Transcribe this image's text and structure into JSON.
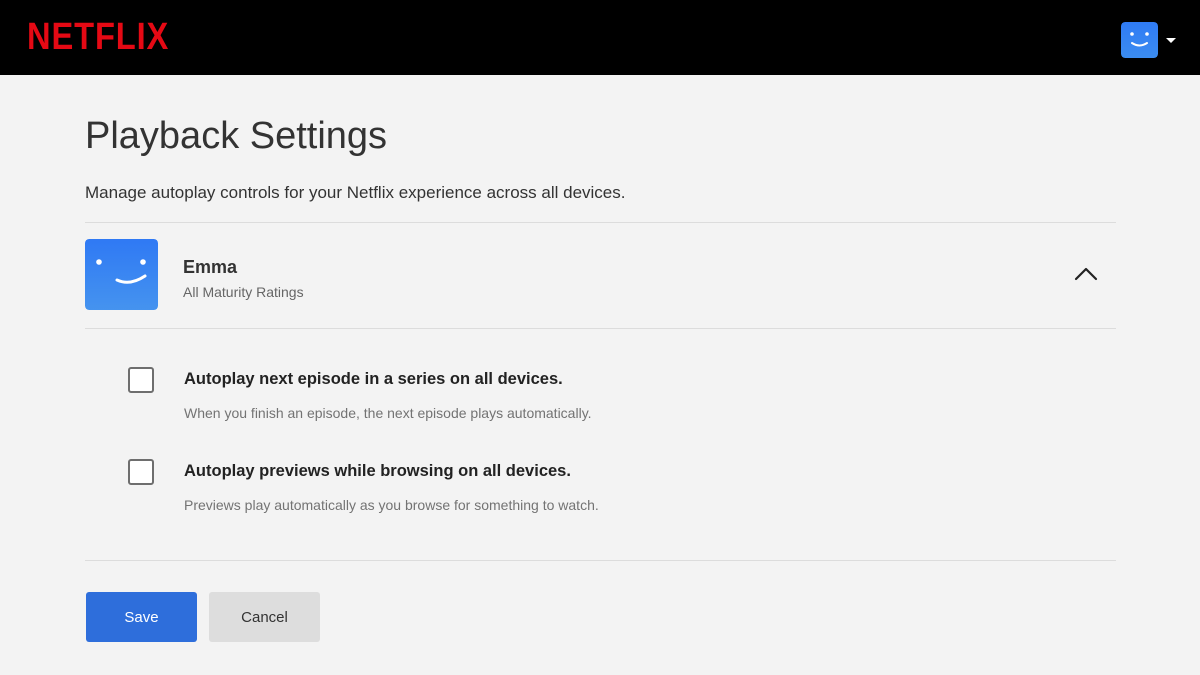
{
  "brand": {
    "logo_text": "NETFLIX",
    "logo_color": "#e50914"
  },
  "header": {
    "avatar_icon": "smiley-profile-icon",
    "menu_icon": "caret-down-icon"
  },
  "page": {
    "title": "Playback Settings",
    "subtitle": "Manage autoplay controls for your Netflix experience across all devices."
  },
  "profile": {
    "name": "Emma",
    "rating": "All Maturity Ratings",
    "avatar_color": "#2f7bf5",
    "expanded": true,
    "toggle_icon": "chevron-up-icon"
  },
  "options": [
    {
      "title": "Autoplay next episode in a series on all devices.",
      "description": "When you finish an episode, the next episode plays automatically.",
      "checked": false
    },
    {
      "title": "Autoplay previews while browsing on all devices.",
      "description": "Previews play automatically as you browse for something to watch.",
      "checked": false
    }
  ],
  "actions": {
    "save_label": "Save",
    "cancel_label": "Cancel",
    "save_color": "#2e6edb"
  }
}
